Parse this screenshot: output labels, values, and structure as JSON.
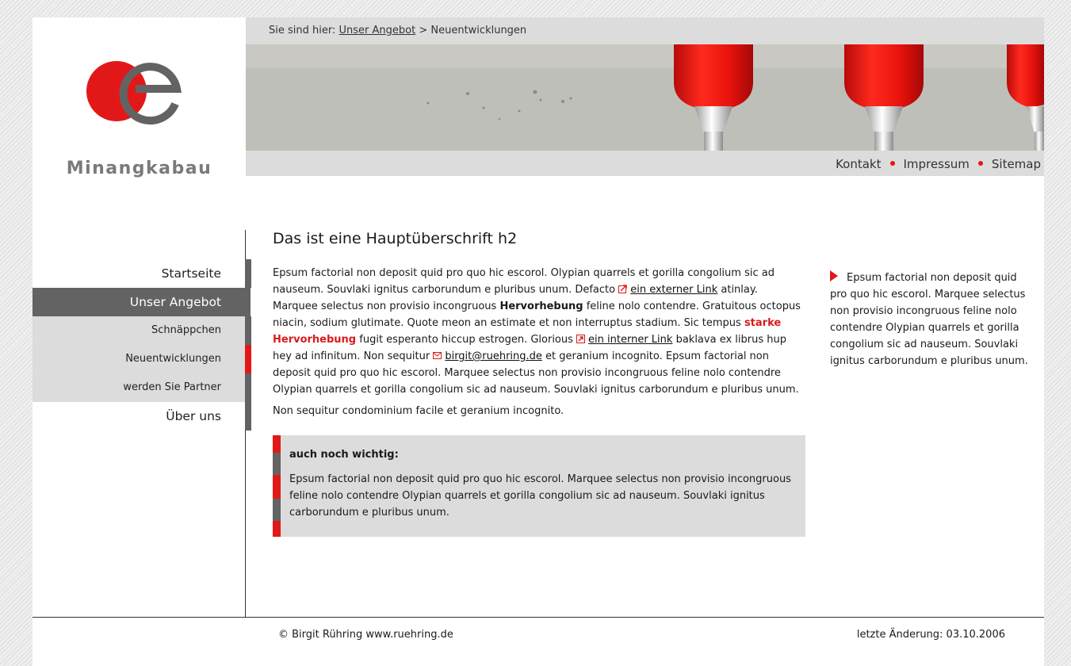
{
  "brand": {
    "name": "Minangkabau",
    "colors": {
      "red": "#e21818",
      "grey": "#636363"
    }
  },
  "breadcrumb": {
    "prefix": "Sie sind hier:",
    "link": "Unser Angebot",
    "separator": ">",
    "current": "Neuentwicklungen"
  },
  "topnav": {
    "items": [
      "Kontakt",
      "Impressum",
      "Sitemap"
    ]
  },
  "sidenav": {
    "items": [
      {
        "label": "Startseite"
      },
      {
        "label": "Unser Angebot"
      },
      {
        "label": "Schnäppchen"
      },
      {
        "label": "Neuentwicklungen"
      },
      {
        "label": "werden Sie Partner"
      },
      {
        "label": "Über uns"
      }
    ]
  },
  "main": {
    "heading": "Das ist eine Hauptüberschrift h2",
    "p1_a": "Epsum factorial non deposit quid pro quo hic escorol. Olypian quarrels et gorilla congolium sic ad nauseum. Souvlaki ignitus carborundum e pluribus unum. Defacto",
    "link_external": "ein externer Link",
    "p1_b": "atinlay. Marquee selectus non provisio incongruous",
    "emphasis": "Hervorhebung",
    "p1_c": "feline nolo contendre. Gratuitous octopus niacin, sodium glutimate. Quote meon an estimate et non interruptus stadium. Sic tempus",
    "strong_emphasis": "starke Hervorhebung",
    "p1_d": "fugit esperanto hiccup estrogen. Glorious",
    "link_internal": "ein interner Link",
    "p1_e": "baklava ex librus hup hey ad infinitum. Non sequitur",
    "email": "birgit@ruehring.de",
    "p1_f": "et geranium incognito. Epsum factorial non deposit quid pro quo hic escorol. Marquee selectus non provisio incongruous feline nolo contendre Olypian quarrels et gorilla congolium sic ad nauseum. Souvlaki ignitus carborundum e pluribus unum.",
    "p2": "Non sequitur condominium facile et geranium incognito.",
    "infobox": {
      "title": "auch noch wichtig:",
      "text": "Epsum factorial non deposit quid pro quo hic escorol. Marquee selectus non provisio incongruous feline nolo contendre Olypian quarrels et gorilla congolium sic ad nauseum. Souvlaki ignitus carborundum e pluribus unum."
    }
  },
  "aside": {
    "text": "Epsum factorial non deposit quid pro quo hic escorol. Marquee selectus non provisio incongruous feline nolo contendre Olypian quarrels et gorilla congolium sic ad nauseum. Souvlaki ignitus carborundum e pluribus unum."
  },
  "footer": {
    "copyright": "© Birgit Rühring www.ruehring.de",
    "updated": "letzte Änderung: 03.10.2006"
  }
}
